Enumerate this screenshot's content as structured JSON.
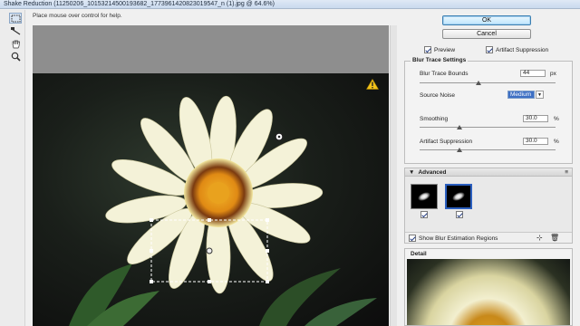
{
  "window": {
    "title": "Shake Reduction (11250206_10153214500193682_1773961420823019547_n (1).jpg @ 64.6%)"
  },
  "help": {
    "text": "Place mouse over control for help."
  },
  "tools": [
    {
      "name": "blur-estimation-tool-icon",
      "active": true
    },
    {
      "name": "blur-direction-tool-icon",
      "active": false
    },
    {
      "name": "hand-tool-icon",
      "active": false
    },
    {
      "name": "zoom-tool-icon",
      "active": false
    }
  ],
  "buttons": {
    "ok": "OK",
    "cancel": "Cancel"
  },
  "options": {
    "preview": {
      "label": "Preview",
      "checked": true
    },
    "artifact_suppression": {
      "label": "Artifact Suppression",
      "checked": true
    }
  },
  "blur_trace": {
    "title": "Blur Trace Settings",
    "bounds": {
      "label": "Blur Trace Bounds",
      "value": "44",
      "unit": "px"
    },
    "source_noise": {
      "label": "Source Noise",
      "value": "Medium"
    },
    "smoothing": {
      "label": "Smoothing",
      "value": "30.0",
      "unit": "%"
    },
    "artifact_suppression": {
      "label": "Artifact Suppression",
      "value": "30.0",
      "unit": "%"
    }
  },
  "advanced": {
    "title": "Advanced",
    "show_regions": {
      "label": "Show Blur Estimation Regions",
      "checked": true
    }
  },
  "detail": {
    "title": "Detail"
  },
  "colors": {
    "select_bg": "#3d6fc4",
    "accent_border": "#2b5fbf"
  }
}
